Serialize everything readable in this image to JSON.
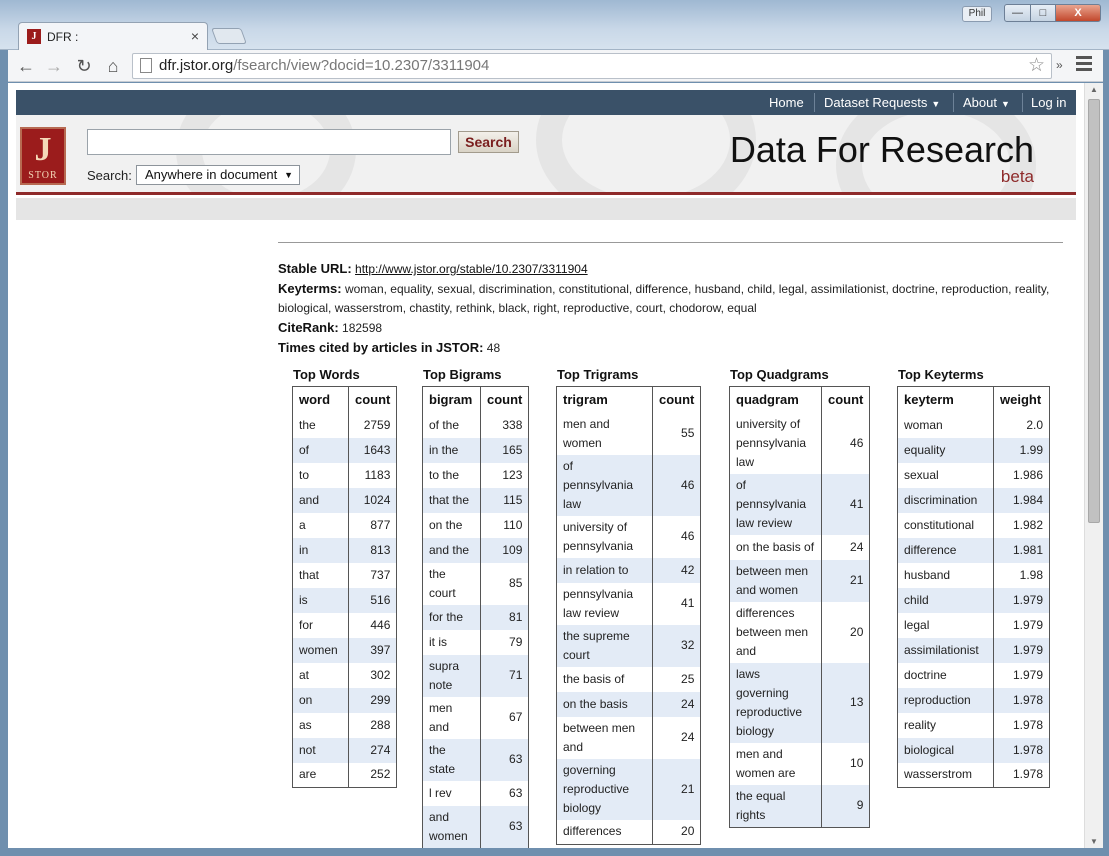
{
  "browser": {
    "tab_title": "DFR :",
    "tab_favicon": "J",
    "tab_close": "×",
    "user_label": "Phil",
    "url_host": "dfr.jstor.org",
    "url_path": "/fsearch/view?docid=10.2307/3311904",
    "nav_icons": [
      "back-arrow-icon",
      "forward-arrow-icon",
      "reload-icon",
      "home-icon"
    ],
    "back_glyph": "←",
    "forward_glyph": "→",
    "reload_glyph": "↻",
    "home_glyph": "⌂",
    "star_glyph": "☆",
    "overflow_glyph": "»",
    "min_glyph": "—",
    "max_glyph": "□",
    "close_glyph": "X"
  },
  "site": {
    "nav": {
      "home": "Home",
      "dataset_requests": "Dataset Requests",
      "about": "About",
      "login": "Log in"
    },
    "logo_letter": "J",
    "logo_text": "STOR",
    "search_button": "Search",
    "search_label": "Search:",
    "search_scope": "Anywhere in document",
    "brand_title": "Data For Research",
    "brand_sub": "beta",
    "accent_color": "#8e2a2a",
    "nav_color": "#3a5168"
  },
  "doc": {
    "stable_url_label": "Stable URL:",
    "stable_url": "http://www.jstor.org/stable/10.2307/3311904",
    "keyterms_label": "Keyterms:",
    "keyterms": "woman, equality, sexual, discrimination, constitutional, difference, husband, child, legal, assimilationist, doctrine, reproduction, reality, biological, wasserstrom, chastity, rethink, black, right, reproductive, court, chodorow, equal",
    "citerank_label": "CiteRank:",
    "citerank": "182598",
    "cited_label": "Times cited by articles in JSTOR:",
    "cited": "48"
  },
  "tables": [
    {
      "title": "Top Words",
      "col1": "word",
      "col2": "count",
      "rows": [
        [
          "the",
          "2759"
        ],
        [
          "of",
          "1643"
        ],
        [
          "to",
          "1183"
        ],
        [
          "and",
          "1024"
        ],
        [
          "a",
          "877"
        ],
        [
          "in",
          "813"
        ],
        [
          "that",
          "737"
        ],
        [
          "is",
          "516"
        ],
        [
          "for",
          "446"
        ],
        [
          "women",
          "397"
        ],
        [
          "at",
          "302"
        ],
        [
          "on",
          "299"
        ],
        [
          "as",
          "288"
        ],
        [
          "not",
          "274"
        ],
        [
          "are",
          "252"
        ]
      ]
    },
    {
      "title": "Top Bigrams",
      "col1": "bigram",
      "col2": "count",
      "rows": [
        [
          "of the",
          "338"
        ],
        [
          "in the",
          "165"
        ],
        [
          "to the",
          "123"
        ],
        [
          "that the",
          "115"
        ],
        [
          "on the",
          "110"
        ],
        [
          "and the",
          "109"
        ],
        [
          "the court",
          "85"
        ],
        [
          "for the",
          "81"
        ],
        [
          "it is",
          "79"
        ],
        [
          "supra note",
          "71"
        ],
        [
          "men and",
          "67"
        ],
        [
          "the state",
          "63"
        ],
        [
          "l rev",
          "63"
        ],
        [
          "and women",
          "63"
        ]
      ]
    },
    {
      "title": "Top Trigrams",
      "col1": "trigram",
      "col2": "count",
      "rows": [
        [
          "men and women",
          "55"
        ],
        [
          "of pennsylvania law",
          "46"
        ],
        [
          "university of pennsylvania",
          "46"
        ],
        [
          "in relation to",
          "42"
        ],
        [
          "pennsylvania law review",
          "41"
        ],
        [
          "the supreme court",
          "32"
        ],
        [
          "the basis of",
          "25"
        ],
        [
          "on the basis",
          "24"
        ],
        [
          "between men and",
          "24"
        ],
        [
          "governing reproductive biology",
          "21"
        ],
        [
          "differences",
          "20"
        ]
      ]
    },
    {
      "title": "Top Quadgrams",
      "col1": "quadgram",
      "col2": "count",
      "rows": [
        [
          "university of pennsylvania law",
          "46"
        ],
        [
          "of pennsylvania law review",
          "41"
        ],
        [
          "on the basis of",
          "24"
        ],
        [
          "between men and women",
          "21"
        ],
        [
          "differences between men and",
          "20"
        ],
        [
          "laws governing reproductive biology",
          "13"
        ],
        [
          "men and women are",
          "10"
        ],
        [
          "the equal rights",
          "9"
        ]
      ]
    },
    {
      "title": "Top Keyterms",
      "col1": "keyterm",
      "col2": "weight",
      "rows": [
        [
          "woman",
          "2.0"
        ],
        [
          "equality",
          "1.99"
        ],
        [
          "sexual",
          "1.986"
        ],
        [
          "discrimination",
          "1.984"
        ],
        [
          "constitutional",
          "1.982"
        ],
        [
          "difference",
          "1.981"
        ],
        [
          "husband",
          "1.98"
        ],
        [
          "child",
          "1.979"
        ],
        [
          "legal",
          "1.979"
        ],
        [
          "assimilationist",
          "1.979"
        ],
        [
          "doctrine",
          "1.979"
        ],
        [
          "reproduction",
          "1.978"
        ],
        [
          "reality",
          "1.978"
        ],
        [
          "biological",
          "1.978"
        ],
        [
          "wasserstrom",
          "1.978"
        ]
      ]
    }
  ]
}
